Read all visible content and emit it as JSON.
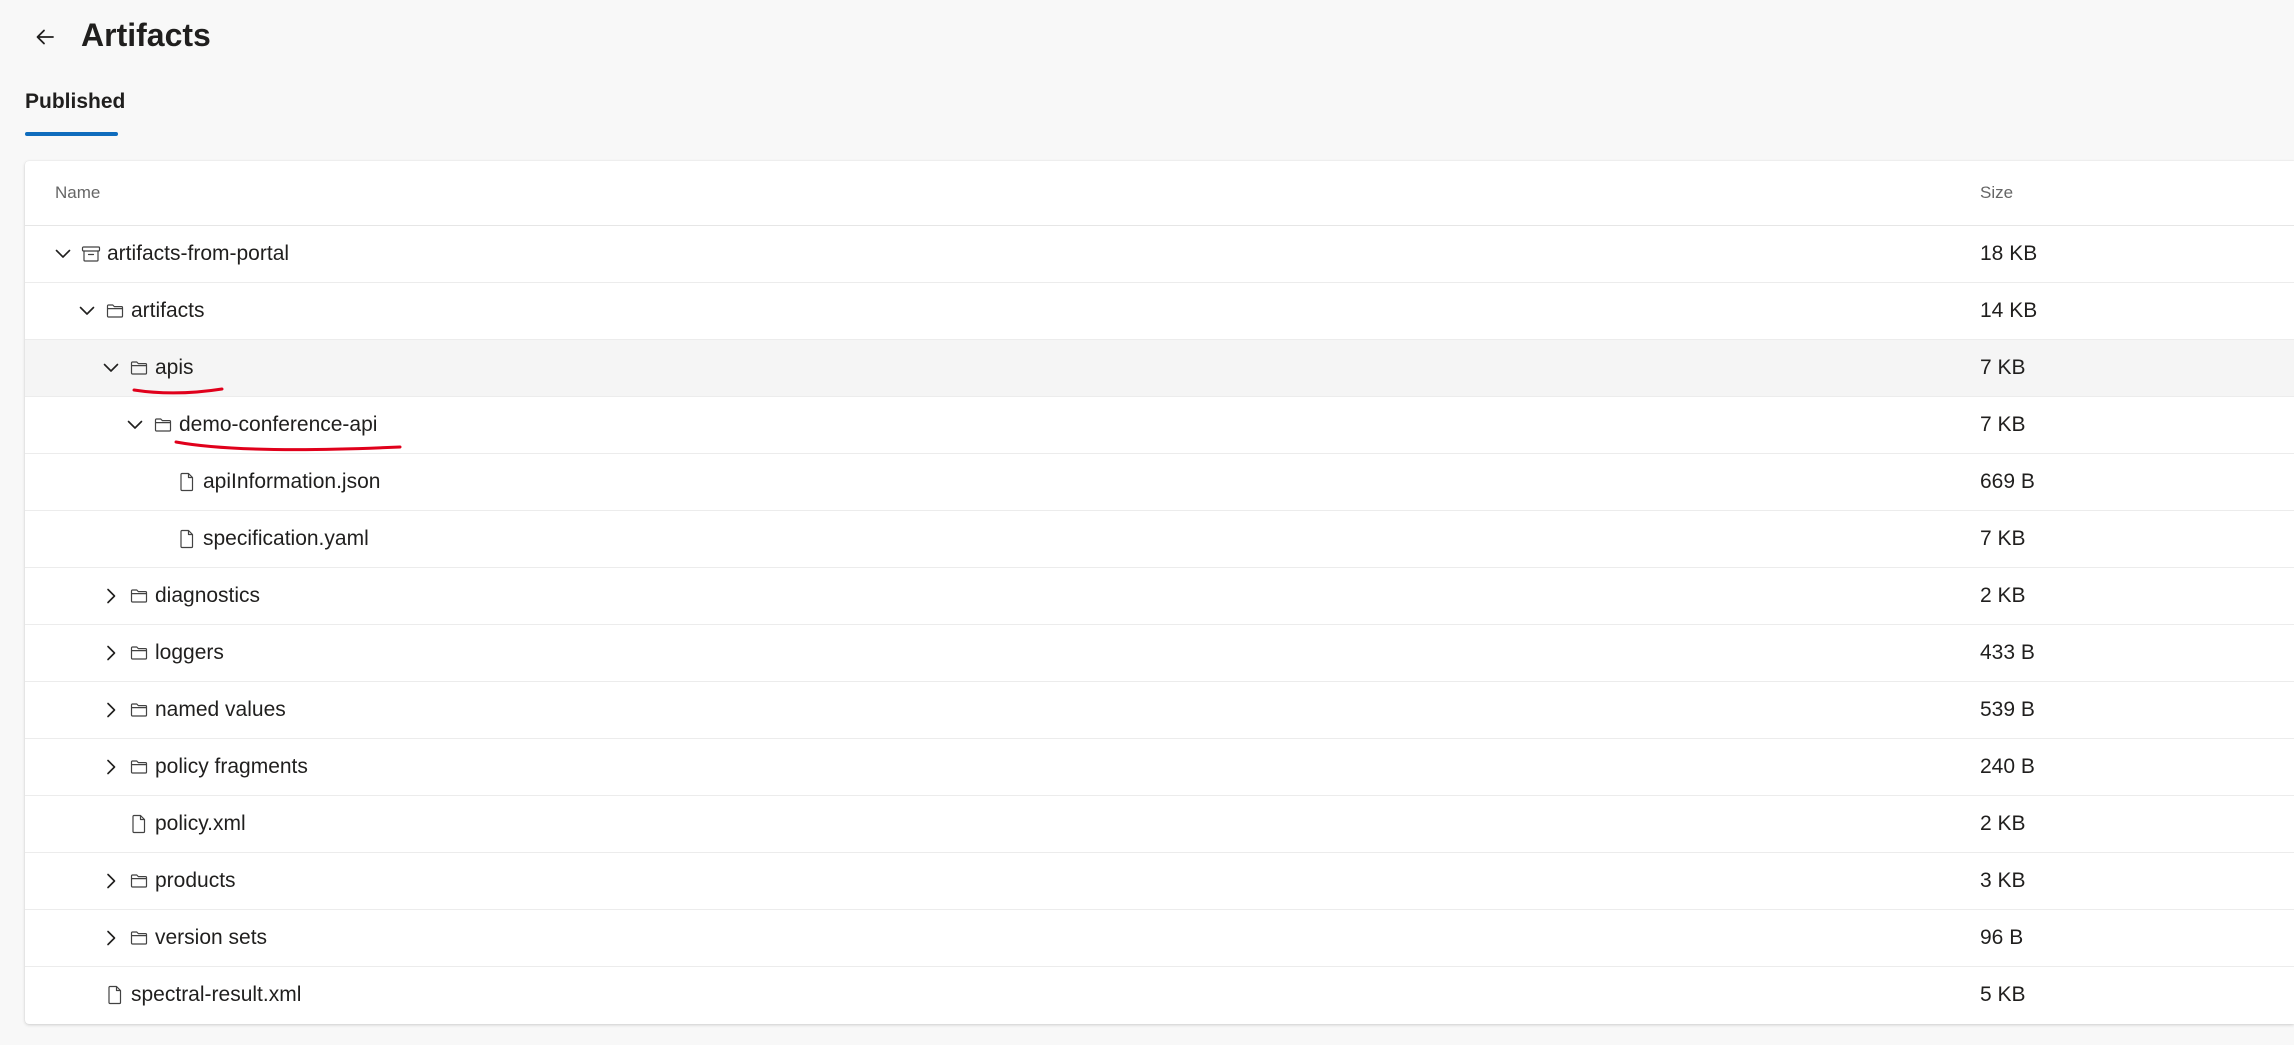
{
  "page": {
    "title": "Artifacts",
    "back_icon": "arrow-left-icon"
  },
  "tabs": [
    {
      "label": "Published",
      "selected": true
    }
  ],
  "table": {
    "columns": {
      "name": "Name",
      "size": "Size"
    },
    "rows": [
      {
        "name": "artifacts-from-portal",
        "size": "18 KB",
        "type": "archive",
        "expanded": true,
        "depth": 0
      },
      {
        "name": "artifacts",
        "size": "14 KB",
        "type": "folder",
        "expanded": true,
        "depth": 1
      },
      {
        "name": "apis",
        "size": "7 KB",
        "type": "folder",
        "expanded": true,
        "depth": 2
      },
      {
        "name": "demo-conference-api",
        "size": "7 KB",
        "type": "folder",
        "expanded": true,
        "depth": 3
      },
      {
        "name": "apiInformation.json",
        "size": "669 B",
        "type": "file",
        "depth": 4
      },
      {
        "name": "specification.yaml",
        "size": "7 KB",
        "type": "file",
        "depth": 4
      },
      {
        "name": "diagnostics",
        "size": "2 KB",
        "type": "folder",
        "expanded": false,
        "depth": 2
      },
      {
        "name": "loggers",
        "size": "433 B",
        "type": "folder",
        "expanded": false,
        "depth": 2
      },
      {
        "name": "named values",
        "size": "539 B",
        "type": "folder",
        "expanded": false,
        "depth": 2
      },
      {
        "name": "policy fragments",
        "size": "240 B",
        "type": "folder",
        "expanded": false,
        "depth": 2
      },
      {
        "name": "policy.xml",
        "size": "2 KB",
        "type": "file",
        "depth": 2
      },
      {
        "name": "products",
        "size": "3 KB",
        "type": "folder",
        "expanded": false,
        "depth": 2
      },
      {
        "name": "version sets",
        "size": "96 B",
        "type": "folder",
        "expanded": false,
        "depth": 2
      },
      {
        "name": "spectral-result.xml",
        "size": "5 KB",
        "type": "file",
        "depth": 1
      }
    ]
  },
  "colors": {
    "accent": "#0f6cbd",
    "annotation": "#e0001b",
    "hover_row": "#f5f5f5"
  }
}
